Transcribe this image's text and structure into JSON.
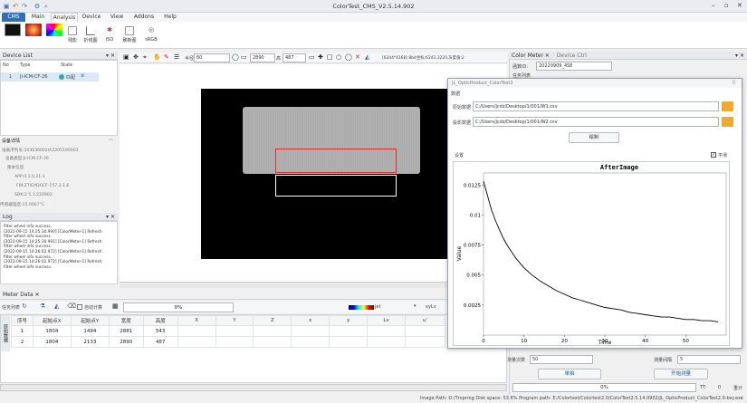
{
  "window": {
    "title": "ColorTest_CMS_V2.5.14.902",
    "controls": [
      "–",
      "▫",
      "✕"
    ]
  },
  "ribbon": {
    "tabs": [
      "CMS",
      "Main",
      "Analysis",
      "Device",
      "View",
      "Addons",
      "Help"
    ],
    "active_tab": "Analysis",
    "buttons": [
      "",
      "",
      "",
      "残影",
      "折线图",
      "ISO",
      "刷新图",
      "sRGB"
    ]
  },
  "device_list": {
    "title": "Device List",
    "columns": [
      "No",
      "Type",
      "State"
    ],
    "rows": [
      {
        "no": "1",
        "type": "JI-ICM-CF-26",
        "state": "匹配"
      }
    ]
  },
  "device_details": {
    "header": "设备详情",
    "lines": [
      "设备序列号:203036002IA2205190003",
      "设备类型:JI-ICM-CF-26",
      "版本信息",
      "APP:0.1.0.21-1",
      "FW:Z7ICM26CF-157.3.1.6",
      "SDK:2.5.1.220902",
      "传感器温度:15.0067°C"
    ]
  },
  "log": {
    "title": "Log",
    "lines": [
      "filter wheel info success.",
      "[2022-09-15 14:25:30.990] [ColorMeter-1] Refresh",
      "filter wheel info success.",
      "[2022-09-15 14:25:30.991] [ColorMeter-1] Refresh",
      "filter wheel info success.",
      "[2022-09-15 14:26:02.972] [ColorMeter-1] Refresh",
      "filter wheel info success.",
      "[2022-09-15 14:26:02.972] [ColorMeter-1] Refresh",
      "filter wheel info success."
    ]
  },
  "image_toolbar": {
    "v1": "60",
    "v2": "2890",
    "v3": "487",
    "info": "[6244*4168] 8bit坐标:6243,3220,灰度值:2"
  },
  "meter_data": {
    "title": "Meter Data",
    "toolbar_label": "任务列表",
    "auto_calc": "自动计算",
    "progress": "0%",
    "colormap": "jet",
    "colorspace": "xyLv",
    "columns": [
      "序号",
      "起始点X",
      "起始点Y",
      "宽度",
      "高度",
      "X",
      "Y",
      "Z",
      "x",
      "y",
      "Lv",
      "u'"
    ],
    "side_label": "原始数据",
    "rows": [
      {
        "n": "1",
        "x0": "1804",
        "y0": "1494",
        "w": "2881",
        "h": "543"
      },
      {
        "n": "2",
        "x0": "1804",
        "y0": "2133",
        "w": "2890",
        "h": "487"
      }
    ]
  },
  "right_panel": {
    "tabs": [
      "Color Meter",
      "Device Ctrl"
    ],
    "id_label": "函数ID:",
    "id_value": "20220909_4SE",
    "task_list": "任务列表",
    "meas_count_label": "测量次数",
    "meas_count": "50",
    "interval_label": "测量间隔",
    "interval": "5",
    "single_btn": "单拍",
    "start_btn": "开始测量",
    "progress": "0%",
    "tt_label": "TT:",
    "tt_value": "0",
    "count_label": "重计"
  },
  "dialog": {
    "title": "JL_OpticProduct_ColorTest2",
    "section_data": "数据",
    "orig_label": "原始数据",
    "orig_path": "C:/Users/jcdz/Desktop/1/001/W1.csv",
    "proj_label": "投影数据",
    "proj_path": "C:/Users/jcdz/Desktop/1/001/W2.csv",
    "draw_btn": "绘制",
    "settings": "设置",
    "smooth": "平滑"
  },
  "chart_data": {
    "type": "line",
    "title": "AfterImage",
    "xlabel": "Time",
    "ylabel": "Value",
    "xlim": [
      0,
      60
    ],
    "ylim": [
      0,
      0.0135
    ],
    "xticks": [
      0,
      10,
      20,
      30,
      40,
      50
    ],
    "yticks": [
      0.0025,
      0.005,
      0.0075,
      0.01,
      0.0125
    ],
    "ytick_labels": [
      "0.0025",
      "0.005",
      "0.0075",
      "0.01",
      "0.0125"
    ],
    "series": [
      {
        "x": [
          0,
          1,
          2,
          3,
          4,
          5,
          6,
          7,
          8,
          9,
          10,
          12,
          14,
          16,
          18,
          20,
          22,
          24,
          26,
          28,
          30,
          32,
          34,
          36,
          38,
          40,
          42,
          44,
          46,
          48,
          50,
          52,
          54,
          56,
          58
        ],
        "y": [
          0.0128,
          0.0116,
          0.0104,
          0.0095,
          0.0087,
          0.008,
          0.0074,
          0.0069,
          0.0064,
          0.006,
          0.0056,
          0.005,
          0.0045,
          0.0041,
          0.0037,
          0.0034,
          0.0031,
          0.0029,
          0.0027,
          0.0025,
          0.0023,
          0.0022,
          0.0021,
          0.0019,
          0.0018,
          0.0017,
          0.0016,
          0.0015,
          0.0015,
          0.0014,
          0.0013,
          0.0013,
          0.0012,
          0.0012,
          0.0011
        ]
      }
    ],
    "grid": false,
    "color": "#000000"
  },
  "status_bar": "Image Path: D:/Tmprmg  Disk space: 53.6%  Program path: E:/Colortest/Colortest2.0/ColorTest2.5.14.0902/JL_OpticProduct_ColorTest2.0-key.exe"
}
